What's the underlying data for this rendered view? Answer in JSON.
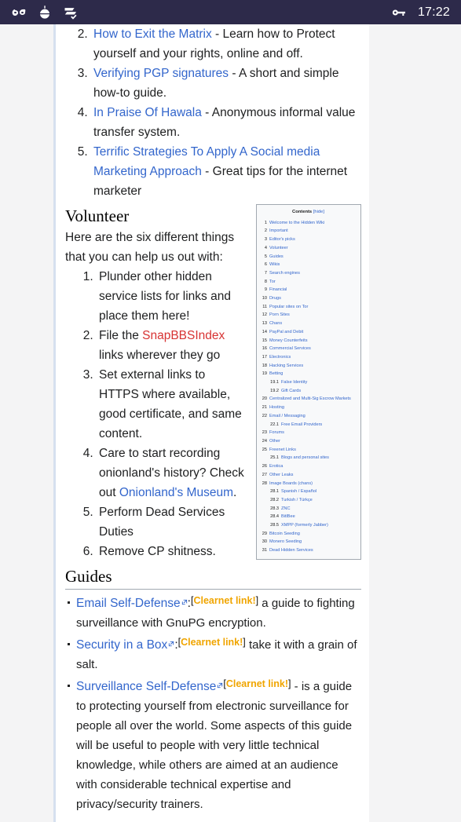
{
  "status_bar": {
    "icons": [
      "infinity-icon",
      "onion-browser-icon",
      "tabs-check-icon"
    ],
    "key_icon": "key-icon",
    "clock": "17:22"
  },
  "theme": {
    "status_bar_bg": "#2d2a4a",
    "link": "#3366cc",
    "red_link": "#d73333",
    "clearnet_badge": "#f0a500",
    "page_bg": "#f4f4f5",
    "content_bg": "#ffffff"
  },
  "editors_picks_continued": [
    {
      "n": "2.",
      "link": "How to Exit the Matrix",
      "desc": " - Learn how to Protect yourself and your rights, online and off."
    },
    {
      "n": "3.",
      "link": "Verifying PGP signatures",
      "desc": " - A short and simple how-to guide."
    },
    {
      "n": "4.",
      "link": "In Praise Of Hawala",
      "desc": " - Anonymous informal value transfer system."
    },
    {
      "n": "5.",
      "link": "Terrific Strategies To Apply A Social media Marketing Approach",
      "desc": " - Great tips for the internet marketer"
    }
  ],
  "volunteer": {
    "heading": "Volunteer",
    "intro": "Here are the six different things that you can help us out with:",
    "items": [
      {
        "pre": "Plunder other hidden service lists for links and place them here!",
        "link": "",
        "post": ""
      },
      {
        "pre": "File the ",
        "link": "SnapBBSIndex",
        "link_style": "red",
        "post": " links wherever they go"
      },
      {
        "pre": "Set external links to HTTPS where available, good certificate, and same content.",
        "link": "",
        "post": ""
      },
      {
        "pre": "Care to start recording onionland's history? Check out ",
        "link": "Onionland's Museum",
        "link_style": "blue",
        "post": "."
      },
      {
        "pre": "Perform Dead Services Duties",
        "link": "",
        "post": ""
      },
      {
        "pre": "Remove CP shitness.",
        "link": "",
        "post": ""
      }
    ]
  },
  "toc": {
    "title": "Contents",
    "hide_label": "[hide]",
    "entries": [
      {
        "num": "1",
        "label": "Welcome to the Hidden Wiki",
        "sub": false
      },
      {
        "num": "2",
        "label": "Important",
        "sub": false
      },
      {
        "num": "3",
        "label": "Editor's picks",
        "sub": false
      },
      {
        "num": "4",
        "label": "Volunteer",
        "sub": false
      },
      {
        "num": "5",
        "label": "Guides",
        "sub": false
      },
      {
        "num": "6",
        "label": "Wikis",
        "sub": false
      },
      {
        "num": "7",
        "label": "Search engines",
        "sub": false
      },
      {
        "num": "8",
        "label": "Tor",
        "sub": false
      },
      {
        "num": "9",
        "label": "Financial",
        "sub": false
      },
      {
        "num": "10",
        "label": "Drugs",
        "sub": false
      },
      {
        "num": "11",
        "label": "Popular sites on Tor",
        "sub": false
      },
      {
        "num": "12",
        "label": "Porn Sites",
        "sub": false
      },
      {
        "num": "13",
        "label": "Chans",
        "sub": false
      },
      {
        "num": "14",
        "label": "PayPal and Debit",
        "sub": false
      },
      {
        "num": "15",
        "label": "Money Counterfeits",
        "sub": false
      },
      {
        "num": "16",
        "label": "Commercial Services",
        "sub": false
      },
      {
        "num": "17",
        "label": "Electronics",
        "sub": false
      },
      {
        "num": "18",
        "label": "Hacking Services",
        "sub": false
      },
      {
        "num": "19",
        "label": "Betting",
        "sub": false
      },
      {
        "num": "19.1",
        "label": "False Identity",
        "sub": true
      },
      {
        "num": "19.2",
        "label": "Gift Cards",
        "sub": true
      },
      {
        "num": "20",
        "label": "Centralized and Multi-Sig Escrow Markets",
        "sub": false
      },
      {
        "num": "21",
        "label": "Hosting",
        "sub": false
      },
      {
        "num": "22",
        "label": "Email / Messaging",
        "sub": false
      },
      {
        "num": "22.1",
        "label": "Free Email Providers",
        "sub": true
      },
      {
        "num": "23",
        "label": "Forums",
        "sub": false
      },
      {
        "num": "24",
        "label": "Other",
        "sub": false
      },
      {
        "num": "25",
        "label": "Freenet Links",
        "sub": false
      },
      {
        "num": "25.1",
        "label": "Blogs and personal sites",
        "sub": true
      },
      {
        "num": "26",
        "label": "Erotica",
        "sub": false
      },
      {
        "num": "27",
        "label": "Other Leaks",
        "sub": false
      },
      {
        "num": "28",
        "label": "Image Boards (chans)",
        "sub": false
      },
      {
        "num": "28.1",
        "label": "Spanish / Español",
        "sub": true
      },
      {
        "num": "28.2",
        "label": "Turkish / Türkçe",
        "sub": true
      },
      {
        "num": "28.3",
        "label": "ZNC",
        "sub": true
      },
      {
        "num": "28.4",
        "label": "BitlBee",
        "sub": true
      },
      {
        "num": "28.5",
        "label": "XMPP (formerly Jabber)",
        "sub": true
      },
      {
        "num": "29",
        "label": "Bitcoin Seeding",
        "sub": false
      },
      {
        "num": "30",
        "label": "Monero Seeding",
        "sub": false
      },
      {
        "num": "31",
        "label": "Dead Hidden Services",
        "sub": false
      }
    ]
  },
  "guides": {
    "heading": "Guides",
    "badge_open": "[",
    "badge_text": "Clearnet link!",
    "badge_close": "]",
    "items": [
      {
        "link": "Email Self-Defense",
        "separator": ":",
        "desc": " a guide to fighting surveillance with GnuPG encryption."
      },
      {
        "link": "Security in a Box",
        "separator": ":",
        "desc": " take it with a grain of salt."
      },
      {
        "link": "Surveillance Self-Defense",
        "separator": "",
        "desc": " - is a guide to protecting yourself from electronic surveillance for people all over the world. Some aspects of this guide will be useful to people with very little technical knowledge, while others are aimed at an audience with considerable technical expertise and privacy/security trainers."
      }
    ]
  }
}
